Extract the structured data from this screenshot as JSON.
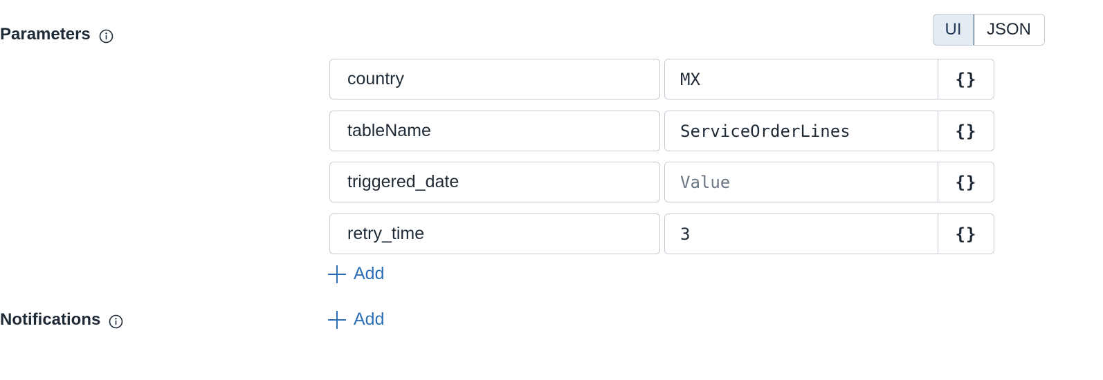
{
  "parameters": {
    "label": "Parameters",
    "rows": [
      {
        "key": "country",
        "value": "MX",
        "value_is_placeholder": false
      },
      {
        "key": "tableName",
        "value": "ServiceOrderLines",
        "value_is_placeholder": false
      },
      {
        "key": "triggered_date",
        "value": "Value",
        "value_is_placeholder": true
      },
      {
        "key": "retry_time",
        "value": "3",
        "value_is_placeholder": false
      }
    ],
    "brace_label": "{}",
    "add_label": "Add"
  },
  "notifications": {
    "label": "Notifications",
    "add_label": "Add"
  },
  "view_toggle": {
    "options": [
      "UI",
      "JSON"
    ],
    "selected": "UI"
  },
  "colors": {
    "text": "#1f2a37",
    "border": "#c5ccd6",
    "accent_link": "#2d6fb6",
    "toggle_selected_bg": "#e4ebf3",
    "toggle_selected_border": "#1f3b5b",
    "placeholder": "#6b7785"
  },
  "icons": {
    "info": "info-circle-icon",
    "add": "plus-icon"
  }
}
